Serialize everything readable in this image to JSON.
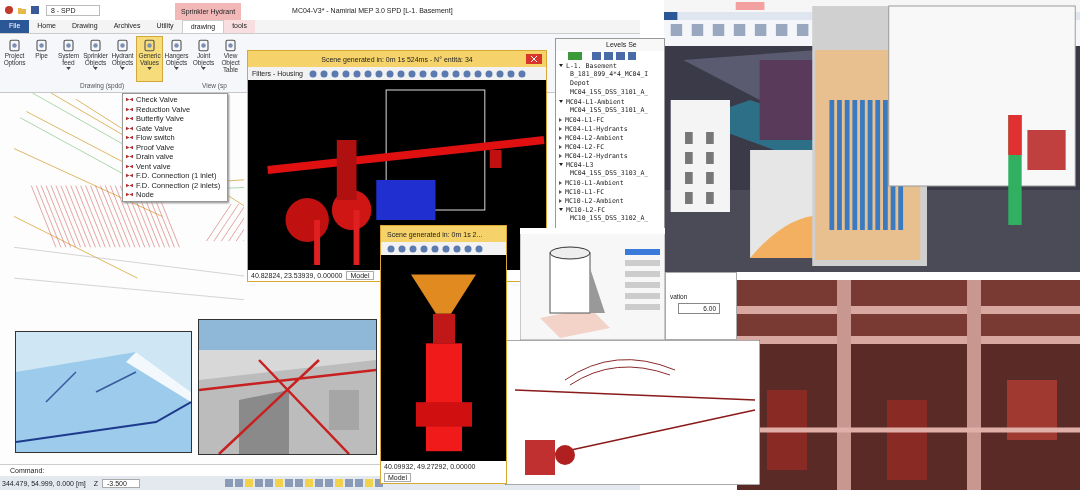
{
  "main_window": {
    "title": "MC04-V3* - Namirial MEP 3.0 SPD [L-1. Basement]",
    "file_field": "8 - SPD",
    "context_tab": "Sprinkler Hydrant",
    "tabs": [
      {
        "label": "File",
        "selected": false,
        "kind": "file"
      },
      {
        "label": "Home",
        "selected": false,
        "kind": "tab"
      },
      {
        "label": "Drawing",
        "selected": false,
        "kind": "tab"
      },
      {
        "label": "Archives",
        "selected": false,
        "kind": "tab"
      },
      {
        "label": "Utility",
        "selected": false,
        "kind": "tab"
      },
      {
        "label": "drawing",
        "selected": true,
        "kind": "context"
      },
      {
        "label": "tools",
        "selected": false,
        "kind": "context"
      }
    ],
    "ribbon": [
      {
        "label": "Project Options",
        "dropdown": false,
        "selected": false
      },
      {
        "label": "Pipe",
        "dropdown": false,
        "selected": false
      },
      {
        "label": "System feed",
        "dropdown": true,
        "selected": false
      },
      {
        "label": "Sprinkler Objects",
        "dropdown": true,
        "selected": false
      },
      {
        "label": "Hydrant Objects",
        "dropdown": true,
        "selected": false
      },
      {
        "label": "Generic Values",
        "dropdown": true,
        "selected": true
      },
      {
        "label": "Hangers Objects",
        "dropdown": true,
        "selected": false
      },
      {
        "label": "Joint Objects",
        "dropdown": true,
        "selected": false
      },
      {
        "label": "View Object Table",
        "dropdown": false,
        "selected": false
      }
    ],
    "groups": [
      "Drawing (spdd)",
      "View (sp"
    ],
    "menu": [
      "Check Valve",
      "Reduction Valve",
      "Butterfly Valve",
      "Gate Valve",
      "Flow switch",
      "Proof Valve",
      "Drain valve",
      "Vent valve",
      "F.D. Connection (1 inlet)",
      "F.D. Connection (2 inlets)",
      "Node"
    ],
    "command_label": "Command:",
    "coords": "344.479, 54.999, 0.000 [m]",
    "z_label": "Z",
    "z_value": "-3.500"
  },
  "scene_window": {
    "title": "Scene generated in: 0m 1s 524ms - N° entità: 34",
    "filter": "Filters - Housing",
    "coords": "40.82824, 23.53939, 0.00000",
    "tab": "Model"
  },
  "levels_window": {
    "title": "Levels Se",
    "tree": [
      {
        "label": "L-1. Basement",
        "expanded": true,
        "children": [
          {
            "label": "B_181_899_4*4_MC04_I"
          },
          {
            "label": "Depot"
          },
          {
            "label": "MC04_1SS_DSS_3101_A_"
          }
        ]
      },
      {
        "label": "MC04-L1-Ambient",
        "expanded": true,
        "children": [
          {
            "label": "MC04_1SS_DSS_3101_A_"
          }
        ]
      },
      {
        "label": "MC04-L1-FC",
        "expanded": false
      },
      {
        "label": "MC04-L1-Hydrants",
        "expanded": false
      },
      {
        "label": "MC04-L2-Ambient",
        "expanded": false
      },
      {
        "label": "MC04-L2-FC",
        "expanded": false
      },
      {
        "label": "MC04-L2-Hydrants",
        "expanded": false
      },
      {
        "label": "MC04-L3",
        "expanded": true,
        "children": [
          {
            "label": "MC04_1SS_DSS_3103_A_"
          }
        ]
      },
      {
        "label": "MC10-L1-Ambient",
        "expanded": false
      },
      {
        "label": "MC10-L1-FC",
        "expanded": false
      },
      {
        "label": "MC10-L2-Ambient",
        "expanded": false
      },
      {
        "label": "MC10-L2-FC",
        "expanded": true,
        "children": [
          {
            "label": "MC10_1SS_DSS_3102_A_"
          }
        ]
      }
    ]
  },
  "scene_window_2": {
    "title": "Scene generated in: 0m 1s 2...",
    "coords": "40.09932, 49.27292, 0.00000",
    "tab": "Model"
  },
  "elevation_panel": {
    "label": "vation",
    "value": "6.00"
  }
}
